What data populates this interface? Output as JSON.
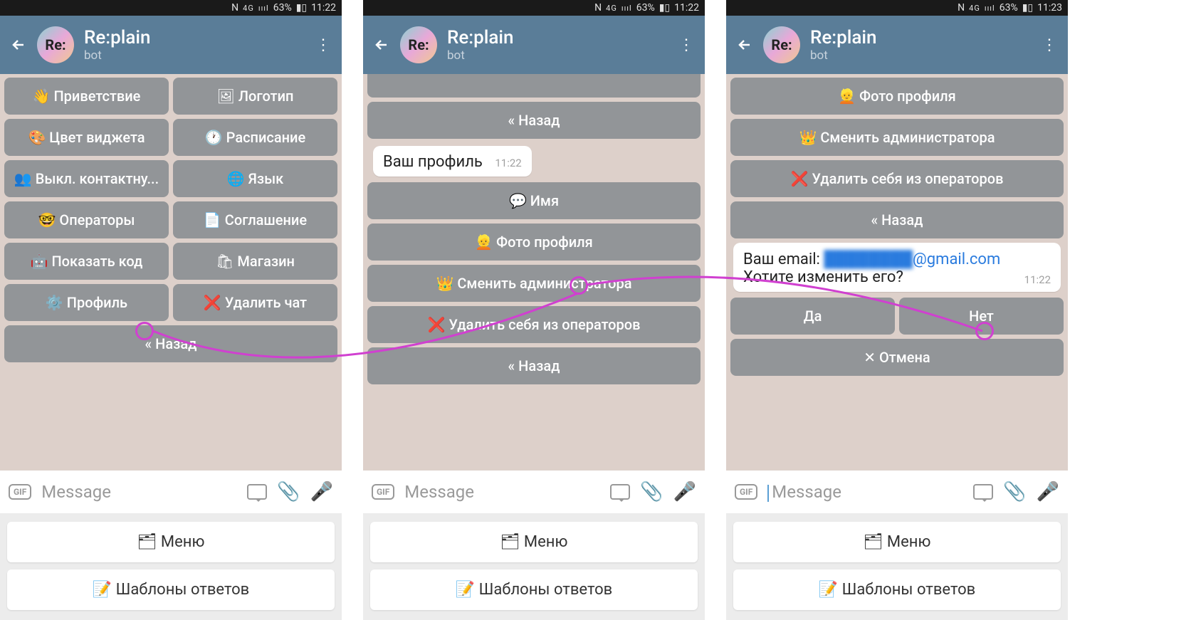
{
  "status": {
    "nfc": "N",
    "net": "4G",
    "signal": "ıııl",
    "battery": "63%",
    "time1": "11:22",
    "time3": "11:23"
  },
  "header": {
    "avatar_text": "Re:",
    "title": "Re:plain",
    "subtitle": "bot"
  },
  "screen1": {
    "buttons": [
      [
        "👋 Приветствие",
        "🖼 Логотип"
      ],
      [
        "🎨 Цвет виджета",
        "🕐 Расписание"
      ],
      [
        "👥 Выкл. контактну...",
        "🌐 Язык"
      ],
      [
        "🤓 Операторы",
        "📄 Соглашение"
      ],
      [
        "🤖 Показать код",
        "🛍 Магазин"
      ],
      [
        "⚙️ Профиль",
        "❌ Удалить чат"
      ]
    ],
    "back": "« Назад"
  },
  "screen2": {
    "top_back": "« Назад",
    "msg": "Ваш профиль",
    "msg_time": "11:22",
    "buttons": [
      "💬 Имя",
      "👱 Фото профиля",
      "👑 Сменить администратора",
      "❌ Удалить себя из операторов",
      "« Назад"
    ]
  },
  "screen3": {
    "top_buttons": [
      "👱 Фото профиля",
      "👑 Сменить администратора",
      "❌ Удалить себя из операторов",
      "« Назад"
    ],
    "msg_prefix": "Ваш email: ",
    "msg_email_blur": "████████",
    "msg_email_suffix": "@gmail.com",
    "msg_line2": "Хотите изменить его?",
    "msg_time": "11:22",
    "yesno": [
      "Да",
      "Нет"
    ],
    "cancel": "✕ Отмена"
  },
  "input": {
    "placeholder": "Message",
    "gif": "GIF"
  },
  "footer": {
    "menu": "🗂 Меню",
    "templates": "📝 Шаблоны ответов"
  }
}
